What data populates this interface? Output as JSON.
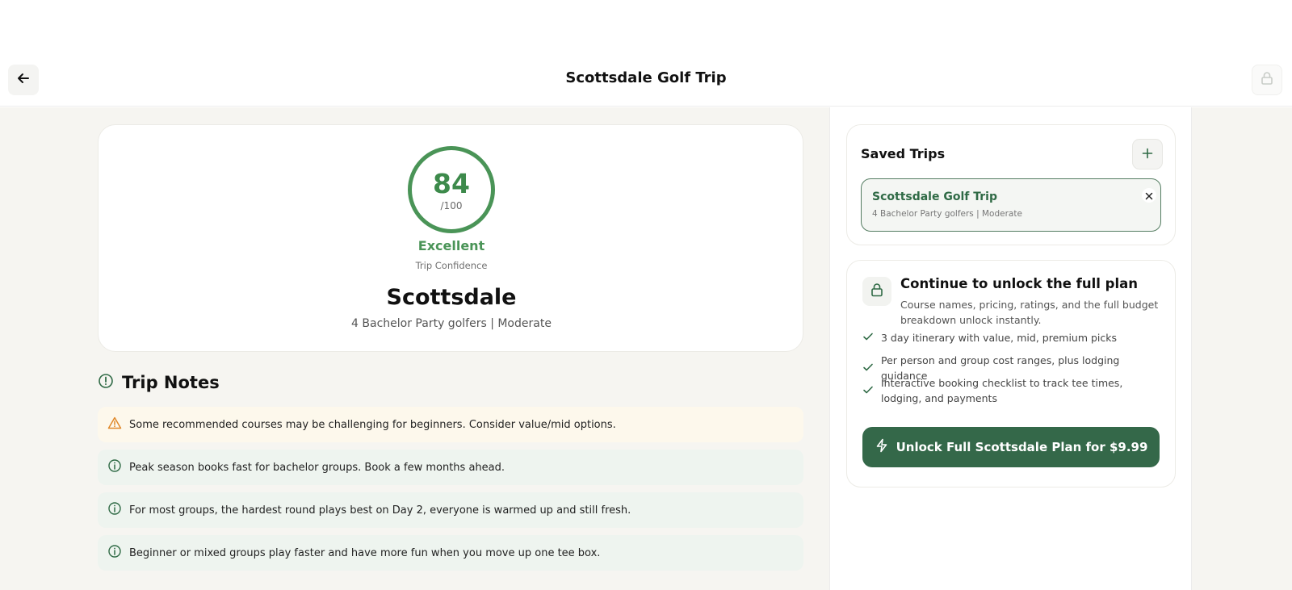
{
  "header": {
    "title": "Scottsdale Golf Trip",
    "back_icon": "arrow-left-icon",
    "lock_icon": "lock-icon"
  },
  "score_card": {
    "score": "84",
    "max": "/100",
    "rating": "Excellent",
    "label": "Trip Confidence",
    "destination": "Scottsdale",
    "subtitle": "4 Bachelor Party golfers | Moderate",
    "accent_color": "#4a9457"
  },
  "trip_notes": {
    "title": "Trip Notes",
    "notes": [
      {
        "type": "warning",
        "text": "Some recommended courses may be challenging for beginners. Consider value/mid options."
      },
      {
        "type": "info",
        "text": "Peak season books fast for bachelor groups. Book a few months ahead."
      },
      {
        "type": "info",
        "text": "For most groups, the hardest round plays best on Day 2, everyone is warmed up and still fresh."
      },
      {
        "type": "info",
        "text": "Beginner or mixed groups play faster and have more fun when you move up one tee box."
      }
    ]
  },
  "saved_trips": {
    "title": "Saved Trips",
    "items": [
      {
        "name": "Scottsdale Golf Trip",
        "meta": "4 Bachelor Party golfers | Moderate"
      }
    ]
  },
  "unlock": {
    "title": "Continue to unlock the full plan",
    "description": "Course names, pricing, ratings, and the full budget breakdown unlock instantly.",
    "features": [
      "3 day itinerary with value, mid, premium picks",
      "Per person and group cost ranges, plus lodging guidance",
      "Interactive booking checklist to track tee times, lodging, and payments"
    ],
    "cta_label": "Unlock Full Scottsdale Plan for $9.99",
    "cta_color": "#346849"
  }
}
